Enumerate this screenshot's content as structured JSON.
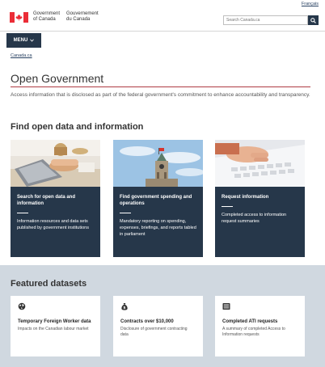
{
  "header": {
    "language_link": "Français",
    "brand_en_line1": "Government",
    "brand_en_line2": "of Canada",
    "brand_fr_line1": "Gouvernement",
    "brand_fr_line2": "du Canada",
    "search_placeholder": "Search Canada.ca",
    "search_icon": "search-icon",
    "flag_icon": "canada-flag-icon"
  },
  "nav": {
    "menu_label": "MENU",
    "menu_icon": "chevron-down-icon"
  },
  "breadcrumb": {
    "home": "Canada.ca"
  },
  "main": {
    "title": "Open Government",
    "lead": "Access information that is disclosed as part of the federal government's commitment to enhance accountability and transparency.",
    "section_heading": "Find open data and information",
    "cards": [
      {
        "title": "Search for open data and information",
        "desc": "Information resources and data sets published by government institutions",
        "image": "laptop-desk-photo"
      },
      {
        "title": "Find government spending and operations",
        "desc": "Mandatory reporting on spending, expenses, briefings, and reports tabled in parliament",
        "image": "peace-tower-photo"
      },
      {
        "title": "Request information",
        "desc": "Completed access to information request summaries",
        "image": "keyboard-typing-photo"
      }
    ]
  },
  "featured": {
    "heading": "Featured datasets",
    "items": [
      {
        "icon": "globe-icon",
        "title": "Temporary Foreign Worker data",
        "desc": "Impacts on the Canadian labour market"
      },
      {
        "icon": "money-bag-icon",
        "title": "Contracts over $10,000",
        "desc": "Disclosure of government contracting data"
      },
      {
        "icon": "document-list-icon",
        "title": "Completed ATI requests",
        "desc": "A summary of completed Access to Information requests"
      }
    ]
  },
  "colors": {
    "brand_dark": "#26374a",
    "accent_red": "#af3c43",
    "flag_red": "#eb2d37",
    "featured_bg": "#d0d8e0",
    "link": "#284162"
  }
}
